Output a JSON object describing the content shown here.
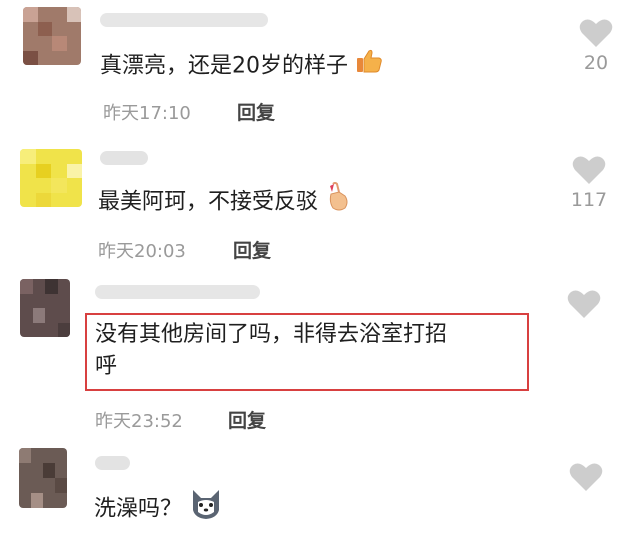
{
  "comments": [
    {
      "text": "真漂亮，还是20岁的样子",
      "time": "昨天17:10",
      "reply": "回复",
      "likes": "20",
      "emoji": "thumbs-up-icon"
    },
    {
      "text": "最美阿珂，不接受反驳",
      "time": "昨天20:03",
      "reply": "回复",
      "likes": "117",
      "emoji": "finger-heart-icon"
    },
    {
      "text_line1": "没有其他房间了吗，非得去浴室打招",
      "text_line2": "呼",
      "time": "昨天23:52",
      "reply": "回复",
      "likes": "",
      "highlight_color": "#d84040"
    },
    {
      "text": "洗澡吗？",
      "likes": "",
      "emoji": "husky-dog-icon"
    }
  ],
  "colors": {
    "heart": "#cdcdcd",
    "meta": "#9a9a9a"
  }
}
